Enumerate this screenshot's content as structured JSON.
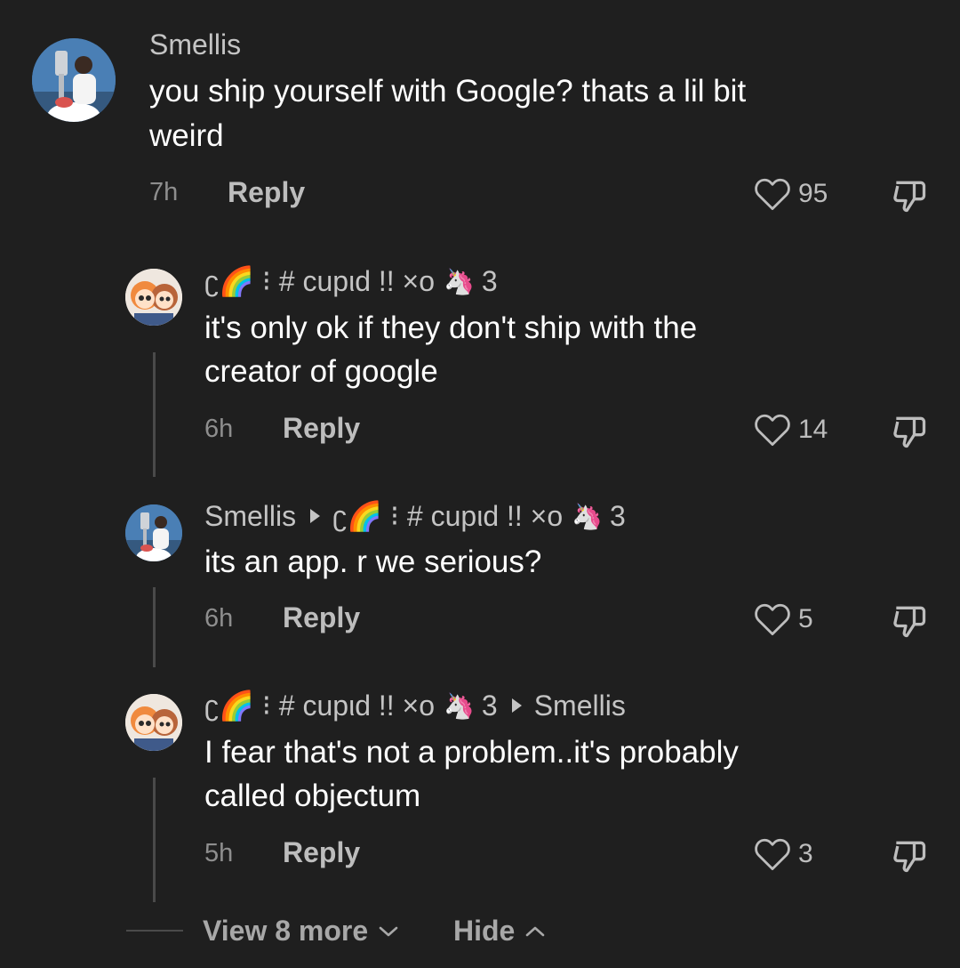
{
  "colors": {
    "background": "#1f1f1f",
    "text": "#ffffff",
    "muted": "#8e8e8e",
    "username": "#c4c4c4"
  },
  "comments": [
    {
      "user": "Smellis",
      "text_line1": "you ship yourself with Google? thats a lil bit",
      "text_line2": "weird",
      "time": "7h",
      "reply": "Reply",
      "likes": "95",
      "avatar": "trophy-photo"
    },
    {
      "user_prefix": "ʗ🌈 ⁝ # cupιd !! ×o",
      "user_suffix": "3",
      "text_line1": "it's only ok if they don't ship with the",
      "text_line2": "creator of google",
      "time": "6h",
      "reply": "Reply",
      "likes": "14",
      "avatar": "cartoon-girls"
    },
    {
      "user": "Smellis",
      "reply_to_prefix": "ʗ🌈 ⁝ # cupιd !! ×o",
      "reply_to_suffix": "3",
      "text_line1": "its an app. r we serious?",
      "time": "6h",
      "reply": "Reply",
      "likes": "5",
      "avatar": "trophy-photo"
    },
    {
      "user_prefix": "ʗ🌈 ⁝ # cupιd !! ×o",
      "user_suffix": "3",
      "reply_to": "Smellis",
      "text_line1": "I fear that's not a problem..it's probably",
      "text_line2": "called objectum",
      "time": "5h",
      "reply": "Reply",
      "likes": "3",
      "avatar": "cartoon-girls"
    }
  ],
  "footer": {
    "view_more": "View 8 more",
    "hide": "Hide"
  }
}
